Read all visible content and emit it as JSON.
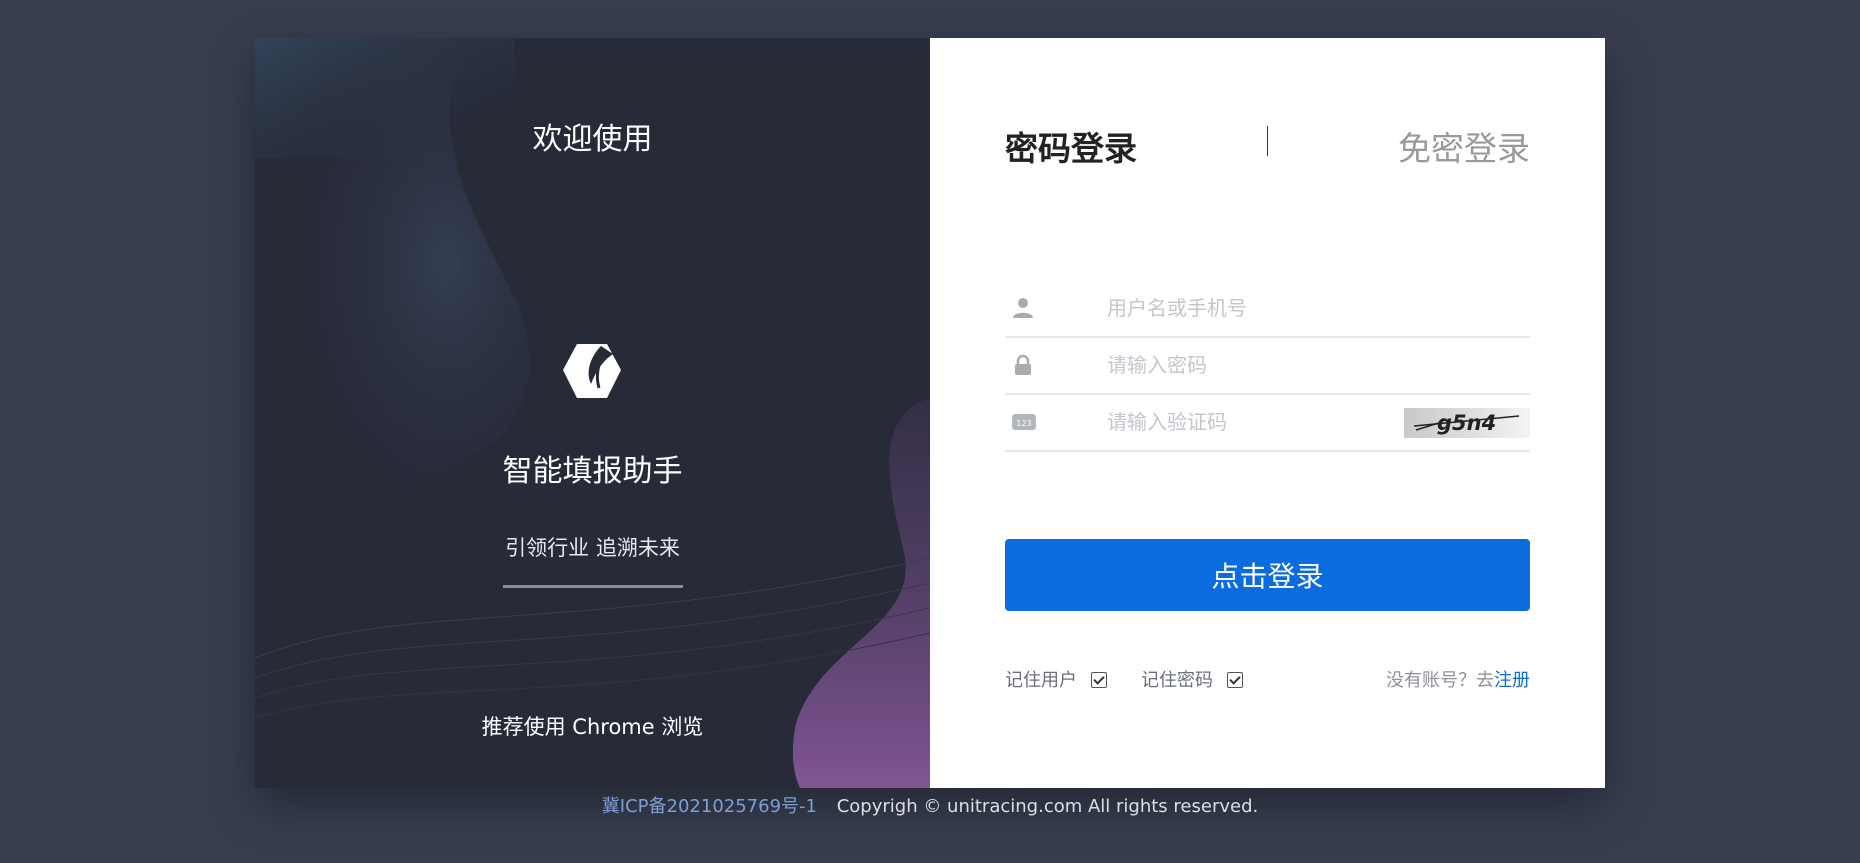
{
  "left_panel": {
    "welcome": "欢迎使用",
    "logo_icon": "leaf-hexagon-logo-icon",
    "app_name": "智能填报助手",
    "slogan": "引领行业 追溯未来",
    "browser_tip": "推荐使用 Chrome 浏览"
  },
  "login": {
    "tabs": [
      {
        "label": "密码登录",
        "active": true
      },
      {
        "label": "免密登录",
        "active": false
      }
    ],
    "fields": {
      "username": {
        "placeholder": "用户名或手机号",
        "value": "",
        "icon": "user-icon"
      },
      "password": {
        "placeholder": "请输入密码",
        "value": "",
        "icon": "lock-icon"
      },
      "captcha": {
        "placeholder": "请输入验证码",
        "value": "",
        "icon": "keypad-123-icon",
        "image_text": "g5n4",
        "icon_text": "123"
      }
    },
    "submit_label": "点击登录",
    "remember_user": {
      "label": "记住用户",
      "checked": true
    },
    "remember_password": {
      "label": "记住密码",
      "checked": true
    },
    "no_account_text": "没有账号？去",
    "register_label": "注册"
  },
  "footer": {
    "icp": "冀ICP备2021025769号-1",
    "copyright": "Copyrigh © unitracing.com All rights reserved."
  },
  "colors": {
    "page_bg": "#383e50",
    "left_bg": "#272a37",
    "accent": "#0b6cdd"
  }
}
